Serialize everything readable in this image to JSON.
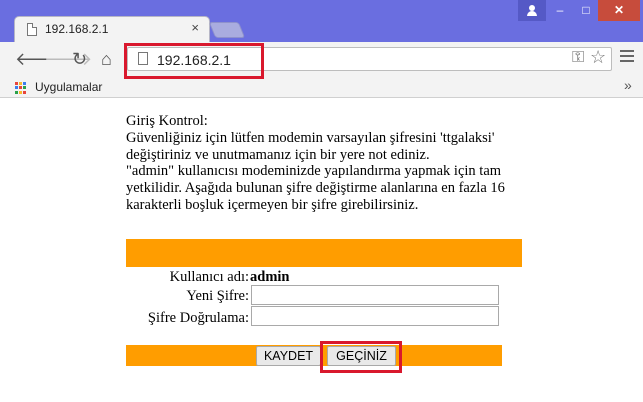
{
  "browser": {
    "tab_title": "192.168.2.1",
    "tab_close": "×",
    "url": "192.168.2.1",
    "bookmarks_label": "Uygulamalar",
    "bookmarks_more": "»",
    "window_min": "–",
    "window_max": "□",
    "window_close": "✕"
  },
  "page": {
    "heading": "Giriş Kontrol:",
    "paragraph1": "Güvenliğiniz için lütfen modemin varsayılan şifresini 'ttgalaksi' değiştiriniz ve unutmamanız için bir yere not ediniz.",
    "paragraph2": "\"admin\" kullanıcısı modeminizde yapılandırma yapmak için tam yetkilidir. Aşağıda bulunan şifre değiştirme alanlarına en fazla 16 karakterli boşluk içermeyen bir şifre girebilirsiniz.",
    "form": {
      "username_label": "Kullanıcı adı:",
      "username_value": "admin",
      "new_password_label": "Yeni Şifre:",
      "new_password_value": "",
      "confirm_password_label": "Şifre Doğrulama:",
      "confirm_password_value": ""
    },
    "buttons": {
      "save": "KAYDET",
      "skip": "GEÇİNİZ"
    }
  },
  "colors": {
    "titlebar": "#6a6ee0",
    "band": "#ff9d00",
    "highlight": "#d9182d"
  },
  "icons": [
    "page-icon",
    "back-arrow-icon",
    "forward-arrow-icon",
    "reload-icon",
    "home-icon",
    "key-icon",
    "star-icon",
    "menu-icon",
    "apps-grid-icon",
    "user-icon"
  ]
}
